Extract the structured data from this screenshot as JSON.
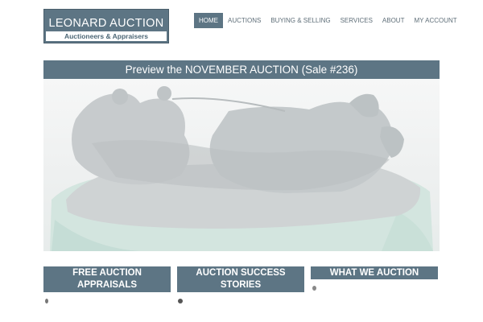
{
  "logo": {
    "title": "LEONARD AUCTION",
    "subtitle": "Auctioneers & Appraisers"
  },
  "nav": {
    "items": [
      {
        "label": "HOME",
        "active": true
      },
      {
        "label": "AUCTIONS",
        "active": false
      },
      {
        "label": "BUYING & SELLING",
        "active": false
      },
      {
        "label": "SERVICES",
        "active": false
      },
      {
        "label": "ABOUT",
        "active": false
      },
      {
        "label": "MY ACCOUNT",
        "active": false
      }
    ]
  },
  "banner": {
    "text": "Preview the NOVEMBER AUCTION (Sale #236)"
  },
  "hero": {
    "image": "bronze-troika-sculpture"
  },
  "boxes": [
    {
      "label": "FREE AUCTION APPRAISALS"
    },
    {
      "label": "AUCTION SUCCESS STORIES"
    },
    {
      "label": "WHAT WE AUCTION"
    }
  ],
  "colors": {
    "accent": "#5d7584",
    "nav_text": "#5e6e78",
    "background": "#ffffff"
  }
}
